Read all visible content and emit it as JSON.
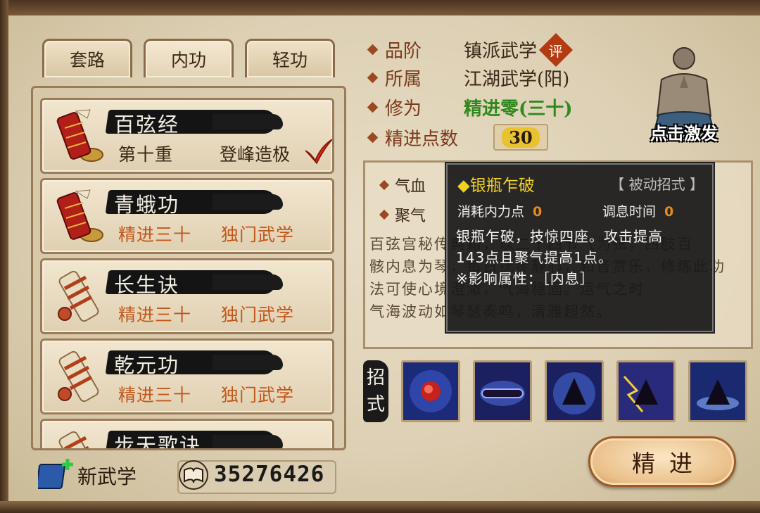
{
  "tabs": [
    {
      "label": "套路"
    },
    {
      "label": "内功"
    },
    {
      "label": "轻功"
    }
  ],
  "martial_list": [
    {
      "name": "百弦经",
      "level": "第十重",
      "status": "登峰造极"
    },
    {
      "name": "青蛾功",
      "level": "精进三十",
      "status": "独门武学"
    },
    {
      "name": "长生诀",
      "level": "精进三十",
      "status": "独门武学"
    },
    {
      "name": "乾元功",
      "level": "精进三十",
      "status": "独门武学"
    },
    {
      "name": "步天歌诀",
      "level": "",
      "status": ""
    }
  ],
  "details": {
    "grade_label": "品阶",
    "grade_value": "镇派武学",
    "grade_badge": "评",
    "belong_label": "所属",
    "belong_value": "江湖武学(阳)",
    "cultivation_label": "修为",
    "cultivation_value": "精进零(三十)",
    "points_label": "精进点数",
    "points_value": "30",
    "avatar_label": "点击激发"
  },
  "desc": {
    "qixue_label": "气血",
    "juqi_label": "聚气",
    "lines": [
      "百弦宫秘传典籍，以二十四节气为弦，四肢百",
      "骸内息为琴，每日抚琴静心，和音赏乐，修炼此功",
      "法可使心境澄澈，气海稳固。运气之时",
      "气海波动如琴瑟奏鸣，清雅超然。"
    ]
  },
  "tooltip": {
    "title": "◆银瓶乍破",
    "tag": "【 被动招式 】",
    "cost_label": "消耗内力点",
    "cost_value": "0",
    "cooldown_label": "调息时间",
    "cooldown_value": "0",
    "lines": [
      "银瓶乍破，技惊四座。攻击提高",
      "143点且聚气提高1点。",
      "※影响属性：［内息］"
    ]
  },
  "skills_label_top": "招",
  "skills_label_bottom": "式",
  "skills": [
    "skill-1-icon",
    "skill-2-icon",
    "skill-3-icon",
    "skill-4-icon",
    "skill-5-icon"
  ],
  "footer": {
    "new_martial_label": "新武学",
    "currency_value": "35276426",
    "advance_button": "精进"
  }
}
